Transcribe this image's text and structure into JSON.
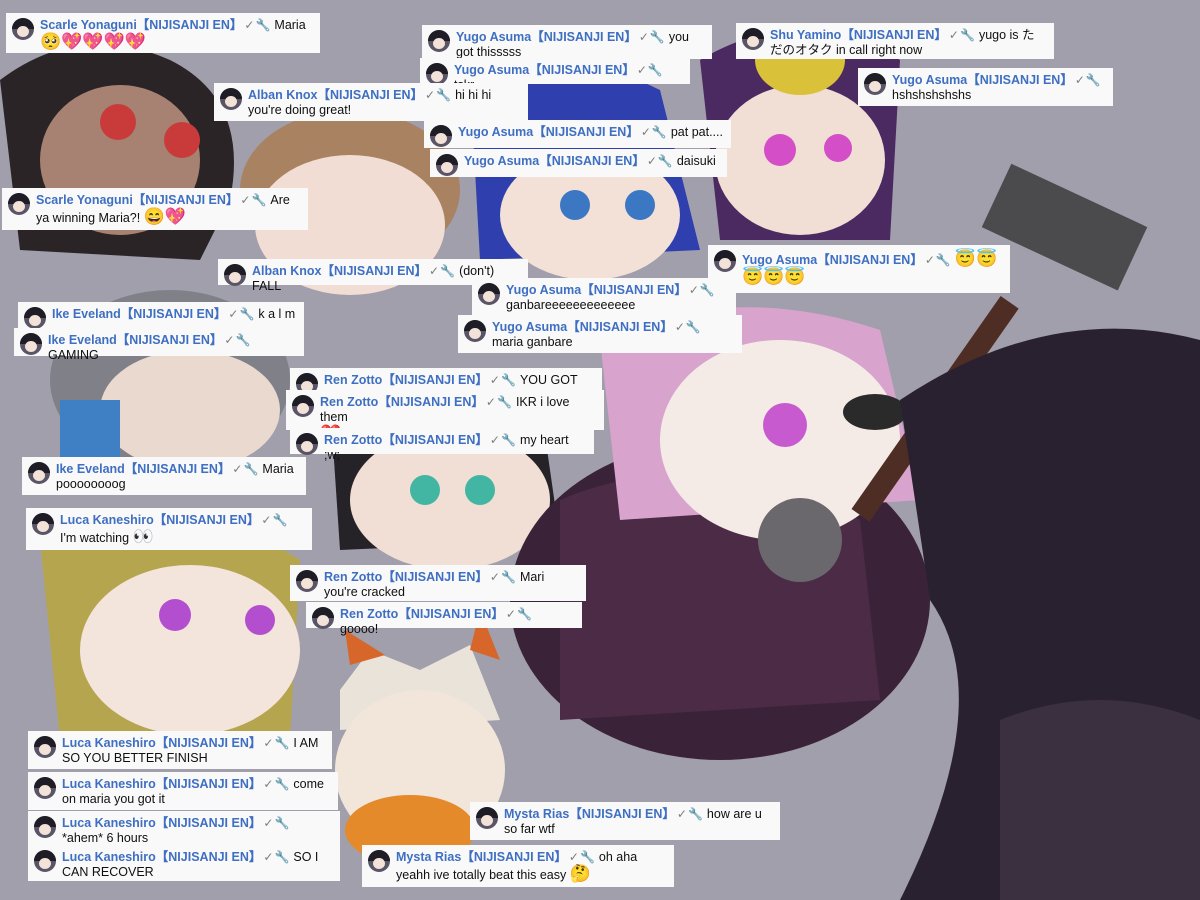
{
  "tag": "【NIJISANJI EN】",
  "check_glyph": "✓",
  "wrench_glyph": "🔧",
  "colors": {
    "background": "#a19fac",
    "name": "#3e6fc2",
    "bubble": "#f9f9f9"
  },
  "messages": [
    {
      "author": "Scarle Yonaguni",
      "text": "Maria",
      "emoji": "🥺💖💖💖💖"
    },
    {
      "author": "Yugo Asuma",
      "text": "you got thisssss",
      "emoji": ""
    },
    {
      "author": "Yugo Asuma",
      "text": "tskr",
      "emoji": ""
    },
    {
      "author": "Shu Yamino",
      "text": "yugo is ただのオタク in call right now",
      "emoji": ""
    },
    {
      "author": "Yugo Asuma",
      "text": "hshshshshshs",
      "emoji": ""
    },
    {
      "author": "Alban Knox",
      "text": "hi hi hi you're doing great!",
      "emoji": ""
    },
    {
      "author": "Yugo Asuma",
      "text": "pat pat....",
      "emoji": ""
    },
    {
      "author": "Yugo Asuma",
      "text": "daisuki",
      "emoji": ""
    },
    {
      "author": "Scarle Yonaguni",
      "text": "Are ya winning Maria?!",
      "emoji": "😄💖"
    },
    {
      "author": "Yugo Asuma",
      "text": "",
      "emoji": "😇😇😇😇😇"
    },
    {
      "author": "Alban Knox",
      "text": "(don't) FALL",
      "emoji": ""
    },
    {
      "author": "Yugo Asuma",
      "text": "ganbareeeeeeeeeeeee",
      "emoji": ""
    },
    {
      "author": "Ike Eveland",
      "text": "k a l m",
      "emoji": ""
    },
    {
      "author": "Ike Eveland",
      "text": "GAMING",
      "emoji": ""
    },
    {
      "author": "Yugo Asuma",
      "text": "maria ganbare",
      "emoji": ""
    },
    {
      "author": "Ren Zotto",
      "text": "YOU GOT THIS",
      "emoji": ""
    },
    {
      "author": "Ren Zotto",
      "text": "IKR i love them",
      "emoji": "❤️"
    },
    {
      "author": "Ren Zotto",
      "text": "my heart ;w;",
      "emoji": ""
    },
    {
      "author": "Ike Eveland",
      "text": "Maria poooooooog",
      "emoji": ""
    },
    {
      "author": "Luca Kaneshiro",
      "text": "I'm watching",
      "emoji": "👀"
    },
    {
      "author": "Ren Zotto",
      "text": "Mari you're cracked",
      "emoji": ""
    },
    {
      "author": "Ren Zotto",
      "text": "goooo!",
      "emoji": ""
    },
    {
      "author": "Luca Kaneshiro",
      "text": "I AM SO YOU BETTER FINISH",
      "emoji": ""
    },
    {
      "author": "Luca Kaneshiro",
      "text": "come on maria you got it",
      "emoji": ""
    },
    {
      "author": "Luca Kaneshiro",
      "text": "*ahem* 6 hours",
      "emoji": ""
    },
    {
      "author": "Mysta Rias",
      "text": "how are u so far wtf",
      "emoji": ""
    },
    {
      "author": "Luca Kaneshiro",
      "text": "SO I CAN RECOVER",
      "emoji": ""
    },
    {
      "author": "Mysta Rias",
      "text": "oh aha yeahh ive totally beat this easy",
      "emoji": "🤔"
    }
  ]
}
